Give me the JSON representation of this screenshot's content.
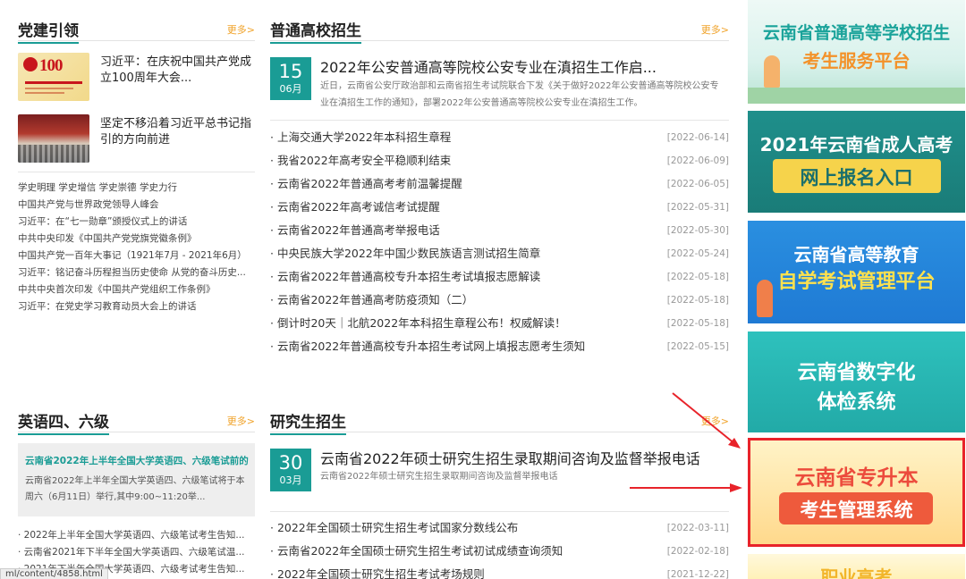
{
  "party": {
    "title": "党建引领",
    "more": "更多>",
    "thumbs": [
      {
        "text": "习近平：在庆祝中国共产党成立100周年大会..."
      },
      {
        "text": "坚定不移沿着习近平总书记指引的方向前进"
      }
    ],
    "list": [
      "学史明理 学史增信 学史崇德 学史力行",
      "中国共产党与世界政党领导人峰会",
      "习近平：在“七一勋章”颁授仪式上的讲话",
      "中共中央印发《中国共产党党旗党徽条例》",
      "中国共产党一百年大事记（1921年7月 - 2021年6月）",
      "习近平：铭记奋斗历程担当历史使命 从党的奋斗历史...",
      "中共中央首次印发《中国共产党组织工作条例》",
      "习近平：在党史学习教育动员大会上的讲话"
    ]
  },
  "admission": {
    "title": "普通高校招生",
    "more": "更多>",
    "featured": {
      "day": "15",
      "month": "06月",
      "title": "2022年公安普通高等院校公安专业在滇招生工作启...",
      "desc": "近日，云南省公安厅政治部和云南省招生考试院联合下发《关于做好2022年公安普通高等院校公安专业在滇招生工作的通知》，部署2022年公安普通高等院校公安专业在滇招生工作。"
    },
    "items": [
      {
        "text": "· 上海交通大学2022年本科招生章程",
        "date": "[2022-06-14]"
      },
      {
        "text": "· 我省2022年高考安全平稳顺利结束",
        "date": "[2022-06-09]"
      },
      {
        "text": "· 云南省2022年普通高考考前温馨提醒",
        "date": "[2022-06-05]"
      },
      {
        "text": "· 云南省2022年高考诚信考试提醒",
        "date": "[2022-05-31]"
      },
      {
        "text": "· 云南省2022年普通高考举报电话",
        "date": "[2022-05-30]"
      },
      {
        "text": "· 中央民族大学2022年中国少数民族语言测试招生简章",
        "date": "[2022-05-24]"
      },
      {
        "text": "· 云南省2022年普通高校专升本招生考试填报志愿解读",
        "date": "[2022-05-18]"
      },
      {
        "text": "· 云南省2022年普通高考防疫须知（二）",
        "date": "[2022-05-18]"
      },
      {
        "text": "· 倒计时20天｜北航2022年本科招生章程公布！权威解读！",
        "date": "[2022-05-18]"
      },
      {
        "text": "· 云南省2022年普通高校专升本招生考试网上填报志愿考生须知",
        "date": "[2022-05-15]"
      }
    ]
  },
  "english": {
    "title": "英语四、六级",
    "more": "更多>",
    "featured_title": "云南省2022年上半年全国大学英语四、六级笔试前的温",
    "featured_desc": "云南省2022年上半年全国大学英语四、六级笔试将于本周六（6月11日）举行,其中9:00~11:20举...",
    "list": [
      "· 2022年上半年全国大学英语四、六级笔试考生告知...",
      "· 云南省2021年下半年全国大学英语四、六级笔试温...",
      "· 2021年下半年全国大学英语四、六级考试考生告知..."
    ]
  },
  "graduate": {
    "title": "研究生招生",
    "more": "更多>",
    "featured": {
      "day": "30",
      "month": "03月",
      "title": "云南省2022年硕士研究生招生录取期间咨询及监督举报电话",
      "desc": "云南省2022年硕士研究生招生录取期间咨询及监督举报电话"
    },
    "items": [
      {
        "text": "· 2022年全国硕士研究生招生考试国家分数线公布",
        "date": "[2022-03-11]"
      },
      {
        "text": "· 云南省2022年全国硕士研究生招生考试初试成绩查询须知",
        "date": "[2022-02-18]"
      },
      {
        "text": "· 2022年全国硕士研究生招生考试考场规则",
        "date": "[2021-12-22]"
      }
    ]
  },
  "banners": [
    {
      "line1": "云南省普通高等学校招生",
      "line2": "考生服务平台"
    },
    {
      "line1": "2021年云南省成人高考",
      "line2": "网上报名入口"
    },
    {
      "line1": "云南省高等教育",
      "line2": "自学考试管理平台"
    },
    {
      "line1": "云南省数字化",
      "line2": "体检系统"
    },
    {
      "line1": "云南省专升本",
      "line2": "考生管理系统"
    },
    {
      "line1": "职业高考",
      "line2": ""
    }
  ],
  "status_url": "ml/content/4858.html",
  "colors": {
    "accent": "#1a9c95",
    "more": "#f0a32a",
    "highlight": "#e8232a"
  }
}
